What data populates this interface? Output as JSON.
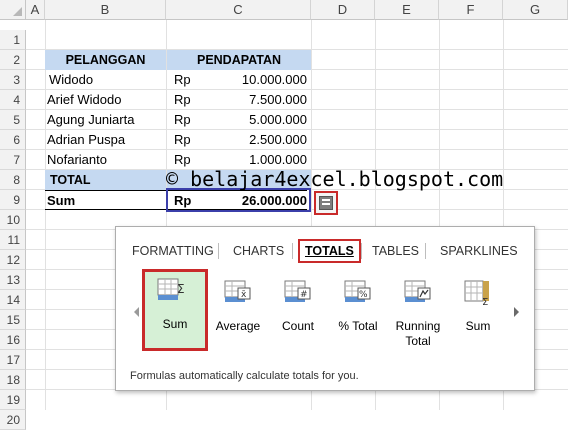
{
  "columns": [
    "A",
    "B",
    "C",
    "D",
    "E",
    "F",
    "G"
  ],
  "rows": [
    "1",
    "2",
    "3",
    "4",
    "5",
    "6",
    "7",
    "8",
    "9",
    "10",
    "11",
    "12",
    "13",
    "14",
    "15",
    "16",
    "17",
    "18",
    "19",
    "20"
  ],
  "table": {
    "header_customer": "PELANGGAN",
    "header_income": "PENDAPATAN",
    "currency": "Rp",
    "records": [
      {
        "name": "Widodo",
        "currency": "Rp",
        "amount": "10.000.000"
      },
      {
        "name": "Arief Widodo",
        "currency": "Rp",
        "amount": "7.500.000"
      },
      {
        "name": "Agung Juniarta",
        "currency": "Rp",
        "amount": "5.000.000"
      },
      {
        "name": "Adrian Puspa",
        "currency": "Rp",
        "amount": "2.500.000"
      },
      {
        "name": "Nofarianto",
        "currency": "Rp",
        "amount": "1.000.000"
      }
    ],
    "total_label": "TOTAL",
    "sum_label": "Sum",
    "sum_currency": "Rp",
    "sum_value": "26.000.000"
  },
  "watermark": "© belajar4excel.blogspot.com",
  "quick_analysis": {
    "tabs": [
      "FORMATTING",
      "CHARTS",
      "TOTALS",
      "TABLES",
      "SPARKLINES"
    ],
    "active_tab": "TOTALS",
    "items": [
      {
        "label": "Sum",
        "icon": "sum-row-icon"
      },
      {
        "label": "Average",
        "icon": "average-icon"
      },
      {
        "label": "Count",
        "icon": "count-icon"
      },
      {
        "label": "% Total",
        "icon": "percent-total-icon"
      },
      {
        "label": "Running Total",
        "icon": "running-total-icon"
      },
      {
        "label": "Sum",
        "icon": "sum-column-icon"
      }
    ],
    "description": "Formulas automatically calculate totals for you."
  },
  "colors": {
    "header_fill": "#c5d9f1",
    "selected_item_fill": "#d6f0d6",
    "highlight_red": "#c92a2a",
    "selection_blue": "#3b3faa"
  }
}
